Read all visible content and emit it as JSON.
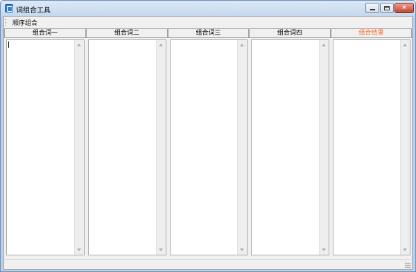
{
  "window": {
    "title": "词组合工具",
    "buttons": {
      "minimize": "minimize",
      "maximize": "maximize",
      "close": "×"
    }
  },
  "menu": {
    "items": [
      "顺序组合"
    ]
  },
  "columns": [
    {
      "header": "组合词一",
      "value": ""
    },
    {
      "header": "组合词二",
      "value": ""
    },
    {
      "header": "组合词三",
      "value": ""
    },
    {
      "header": "组合词四",
      "value": ""
    },
    {
      "header": "组合结果",
      "value": ""
    }
  ],
  "colors": {
    "result_header": "#ff6a2b"
  }
}
